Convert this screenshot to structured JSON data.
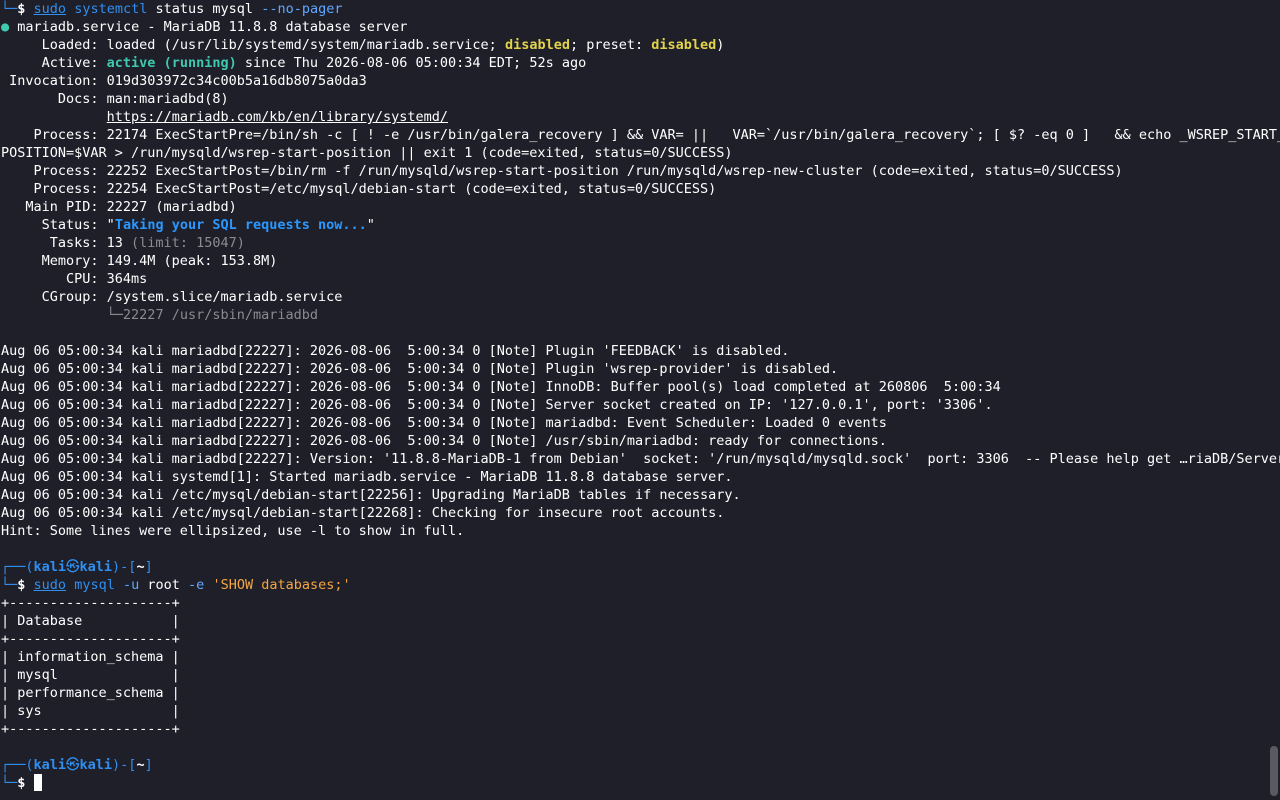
{
  "first_prompt_tail": {
    "corner": "└─",
    "dollar": "$",
    "sudo": "sudo",
    "cmd": "systemctl",
    "args": "status mysql",
    "opt": "--no-pager"
  },
  "service": {
    "dot": "●",
    "title": "mariadb.service - MariaDB 11.8.8 database server",
    "loaded_label": "     Loaded: ",
    "loaded_a": "loaded (/usr/lib/systemd/system/mariadb.service; ",
    "loaded_disabled1": "disabled",
    "loaded_b": "; preset: ",
    "loaded_disabled2": "disabled",
    "loaded_c": ")",
    "active_label": "     Active: ",
    "active_state": "active (running)",
    "active_rest": " since Thu 2026-08-06 05:00:34 EDT; 52s ago",
    "invocation": " Invocation: 019d303972c34c00b5a16db8075a0da3",
    "docs_label": "       Docs: ",
    "docs_1": "man:mariadbd(8)",
    "docs_2_indent": "             ",
    "docs_2": "https://mariadb.com/kb/en/library/systemd/",
    "process1_a": "    Process: 22174 ExecStartPre=/bin/sh -c [ ! -e /usr/bin/galera_recovery ] && VAR= ||   VAR=`/usr/bin/galera_recovery`; [ $? -eq 0 ]   && echo _WSREP_START_",
    "process1_b": "POSITION=$VAR > /run/mysqld/wsrep-start-position || exit 1 (code=exited, status=0/SUCCESS)",
    "process2": "    Process: 22252 ExecStartPost=/bin/rm -f /run/mysqld/wsrep-start-position /run/mysqld/wsrep-new-cluster (code=exited, status=0/SUCCESS)",
    "process3": "    Process: 22254 ExecStartPost=/etc/mysql/debian-start (code=exited, status=0/SUCCESS)",
    "mainpid": "   Main PID: 22227 (mariadbd)",
    "status_label": "     Status: ",
    "status_q1": "\"",
    "status_text": "Taking your SQL requests now...",
    "status_q2": "\"",
    "tasks_label": "      Tasks: 13 ",
    "tasks_limit": "(limit: 15047)",
    "memory": "     Memory: 149.4M (peak: 153.8M)",
    "cpu": "        CPU: 364ms",
    "cgroup": "     CGroup: /system.slice/mariadb.service",
    "cgroup_tree_indent": "             ",
    "cgroup_tree": "└─22227 /usr/sbin/mariadbd"
  },
  "log_lines": [
    "Aug 06 05:00:34 kali mariadbd[22227]: 2026-08-06  5:00:34 0 [Note] Plugin 'FEEDBACK' is disabled.",
    "Aug 06 05:00:34 kali mariadbd[22227]: 2026-08-06  5:00:34 0 [Note] Plugin 'wsrep-provider' is disabled.",
    "Aug 06 05:00:34 kali mariadbd[22227]: 2026-08-06  5:00:34 0 [Note] InnoDB: Buffer pool(s) load completed at 260806  5:00:34",
    "Aug 06 05:00:34 kali mariadbd[22227]: 2026-08-06  5:00:34 0 [Note] Server socket created on IP: '127.0.0.1', port: '3306'.",
    "Aug 06 05:00:34 kali mariadbd[22227]: 2026-08-06  5:00:34 0 [Note] mariadbd: Event Scheduler: Loaded 0 events",
    "Aug 06 05:00:34 kali mariadbd[22227]: 2026-08-06  5:00:34 0 [Note] /usr/sbin/mariadbd: ready for connections.",
    "Aug 06 05:00:34 kali mariadbd[22227]: Version: '11.8.8-MariaDB-1 from Debian'  socket: '/run/mysqld/mysqld.sock'  port: 3306  -- Please help get …riaDB/Server",
    "Aug 06 05:00:34 kali systemd[1]: Started mariadb.service - MariaDB 11.8.8 database server.",
    "Aug 06 05:00:34 kali /etc/mysql/debian-start[22256]: Upgrading MariaDB tables if necessary.",
    "Aug 06 05:00:34 kali /etc/mysql/debian-start[22268]: Checking for insecure root accounts.",
    "Hint: Some lines were ellipsized, use -l to show in full."
  ],
  "prompt": {
    "top_a": "┌──(",
    "user": "kali",
    "at": "㉿",
    "host": "kali",
    "top_b": ")-[",
    "path": "~",
    "top_c": "]",
    "corner": "└─",
    "dollar": "$"
  },
  "cmd2": {
    "sudo": "sudo",
    "cmd": "mysql",
    "opt": "-u",
    "arg": "root",
    "opt2": "-e",
    "query": "'SHOW databases;'"
  },
  "db_table": [
    "+--------------------+",
    "| Database           |",
    "+--------------------+",
    "| information_schema |",
    "| mysql              |",
    "| performance_schema |",
    "| sys                |",
    "+--------------------+"
  ]
}
